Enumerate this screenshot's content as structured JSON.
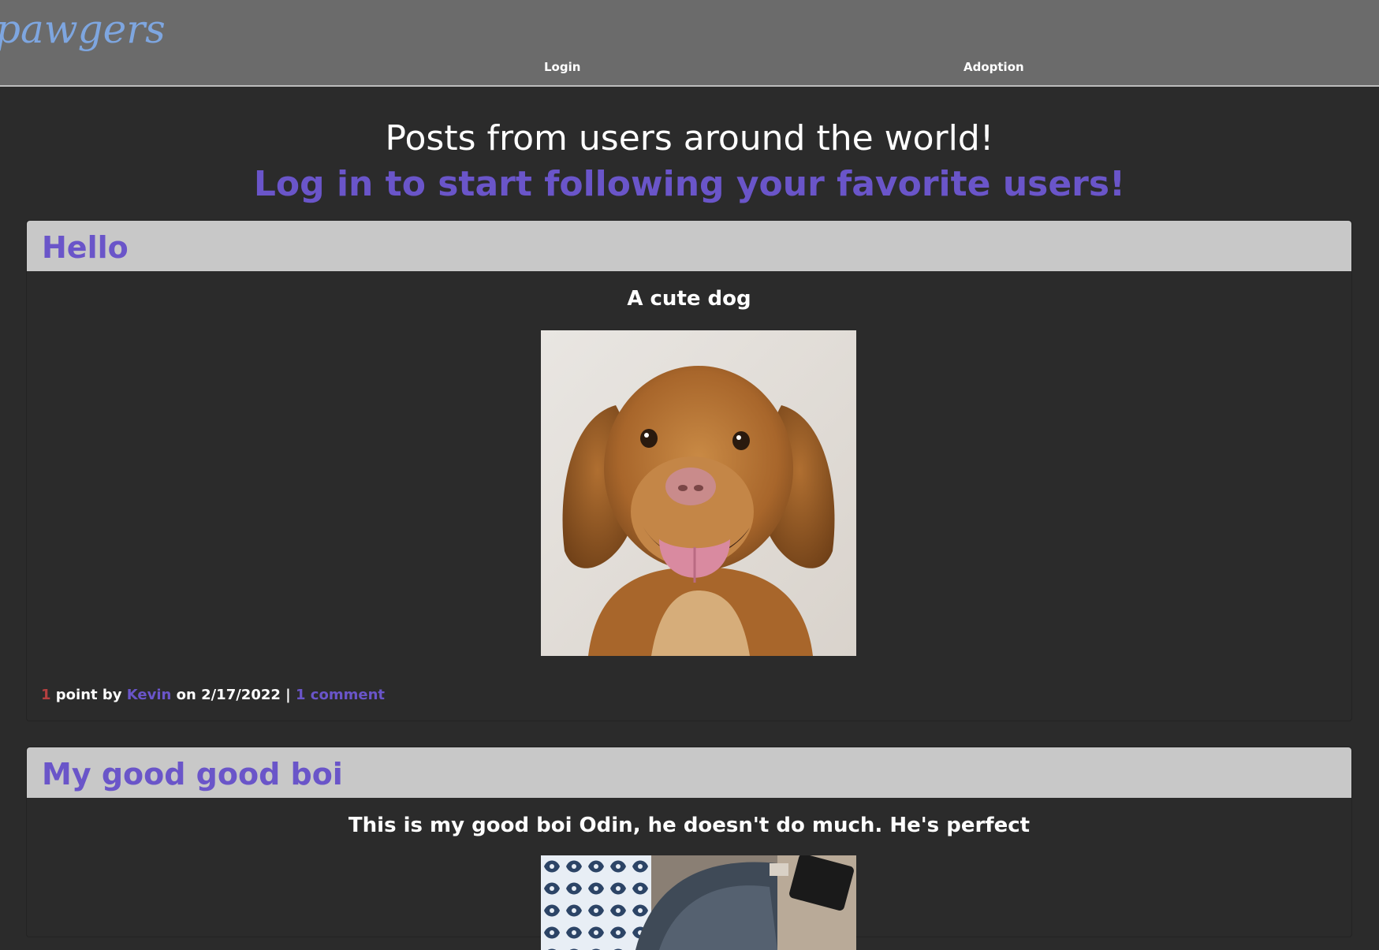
{
  "header": {
    "logo_text": "pawgers",
    "nav": {
      "login": "Login",
      "adoption": "Adoption"
    }
  },
  "intro": {
    "line1": "Posts from users around the world!",
    "line2": "Log in to start following your favorite users!"
  },
  "posts": [
    {
      "title": "Hello",
      "caption": "A cute dog",
      "image_alt": "dog-photo",
      "points": "1",
      "points_label": " point by ",
      "author": "Kevin",
      "date_prefix": " on ",
      "date": "2/17/2022",
      "separator": " | ",
      "comments": "1 comment"
    },
    {
      "title": "My good good boi",
      "caption": "This is my good boi Odin, he doesn't do much. He's perfect",
      "image_alt": "dog-photo"
    }
  ],
  "colors": {
    "header_bg": "#6b6b6b",
    "page_bg": "#2b2b2b",
    "accent": "#6a55c9",
    "logo": "#7ea6e0",
    "post_header_bg": "#c8c8c8",
    "points": "#b54040"
  }
}
